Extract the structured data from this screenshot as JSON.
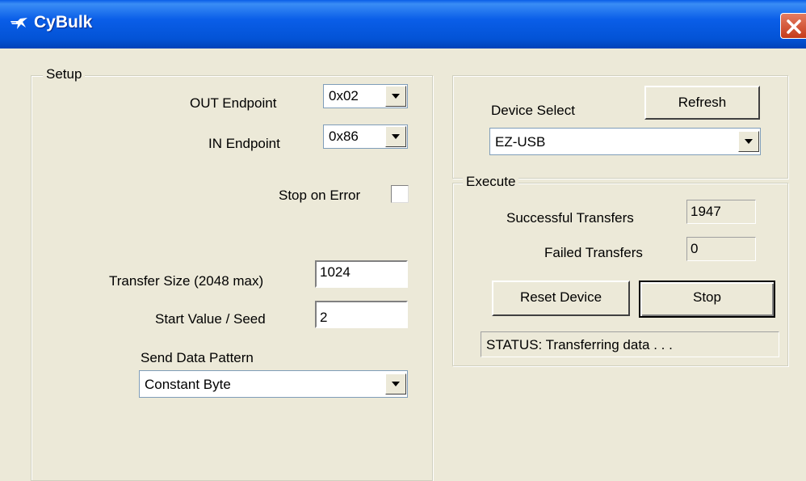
{
  "window": {
    "title": "CyBulk",
    "icon": "cypress-logo-icon"
  },
  "setup": {
    "legend": "Setup",
    "out_endpoint_label": "OUT Endpoint",
    "out_endpoint_value": "0x02",
    "in_endpoint_label": "IN Endpoint",
    "in_endpoint_value": "0x86",
    "stop_on_error_label": "Stop on Error",
    "stop_on_error_checked": false,
    "transfer_size_label": "Transfer Size (2048 max)",
    "transfer_size_value": "1024",
    "start_value_label": "Start Value / Seed",
    "start_value_value": "2",
    "pattern_label": "Send Data Pattern",
    "pattern_value": "Constant Byte"
  },
  "device": {
    "select_label": "Device Select",
    "refresh_label": "Refresh",
    "selected_device": "EZ-USB"
  },
  "execute": {
    "legend": "Execute",
    "successful_label": "Successful Transfers",
    "successful_value": "1947",
    "failed_label": "Failed Transfers",
    "failed_value": "0",
    "reset_label": "Reset Device",
    "stop_label": "Stop",
    "status_text": "STATUS: Transferring data . . ."
  }
}
